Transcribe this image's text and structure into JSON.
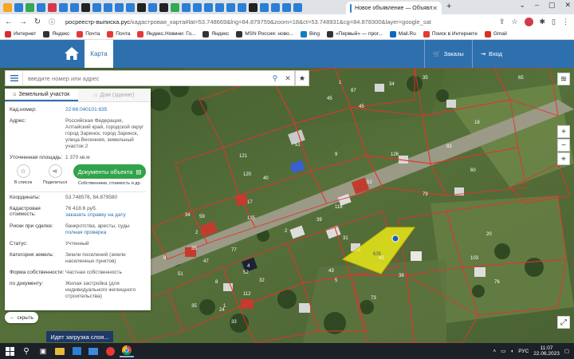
{
  "browser": {
    "active_tab_title": "Новое объявление — Объявл",
    "url_host": "росреестр-выписка.рус",
    "url_path": "/кадастровая_карта#lat=53.748669&lng=84.879759&zoom=18&ct=53.748931&cg=84.878300&layer=google_sat",
    "bookmarks": [
      {
        "label": "Интернет",
        "color": "#d32f2f"
      },
      {
        "label": "Яндекс",
        "color": "#333333"
      },
      {
        "label": "Почта",
        "color": "#e53935"
      },
      {
        "label": "Почта",
        "color": "#e53935"
      },
      {
        "label": "Яндекс.Новини: Го...",
        "color": "#e53935"
      },
      {
        "label": "Яндекс",
        "color": "#333333"
      },
      {
        "label": "MSN Россия: ново...",
        "color": "#333333"
      },
      {
        "label": "Bing",
        "color": "#0f7dc2"
      },
      {
        "label": "«Первый» — прог...",
        "color": "#333333"
      },
      {
        "label": "Mail.Ru",
        "color": "#0c66c2"
      },
      {
        "label": "Поиск в Интернете",
        "color": "#e53935"
      },
      {
        "label": "Gmail",
        "color": "#d93025"
      }
    ]
  },
  "header": {
    "map_tab": "Карта",
    "orders": "Заказы",
    "login": "Вход"
  },
  "search": {
    "placeholder": "введите номер или адрес"
  },
  "panel": {
    "tab_land": "Земельный участок",
    "tab_building": "Дом (здание)",
    "cad_label": "Кад.номер:",
    "cad_value": "22:66:040101:635",
    "addr_label": "Адрес:",
    "addr_value": "Российская Федерация, Алтайский край, городской округ город Заринск, город Заринск, улица Весенняя, земельный участок 2",
    "area_label": "Уточненная площадь:",
    "area_value": "1 370 кв.м",
    "in_list": "В список",
    "share": "Поделиться",
    "docs_button": "Документы объекта",
    "docs_sub": "Собственники, стоимость и др.",
    "coords_label": "Координаты:",
    "coords_value": "53.748576, 84.879580",
    "cost_label": "Кадастровая стоимость:",
    "cost_value": "76 418.6 руб.",
    "cost_link": "заказать справку на дату",
    "risks_label": "Риски при сделке:",
    "risks_value": "банкротства, аресты, суды",
    "risks_link": "полная проверка",
    "status_label": "Статус:",
    "status_value": "Учтенный",
    "category_label": "Категория земель:",
    "category_value": "Земли поселений (земли населенных пунктов)",
    "ownership_label": "Форма собственности:",
    "ownership_value": "Частная собственность",
    "doc_label": "по документу:",
    "doc_value": "Жилая застройка (для индивидуального жилищного строительства)"
  },
  "hide_button": "скрыть",
  "loading_text": "Идет загрузка слоя...",
  "map_labels": [
    "65",
    "34",
    "35",
    "87",
    "45",
    "45",
    "1",
    "83",
    "18",
    "51",
    "126",
    "60",
    "9",
    "121",
    "120",
    "40",
    "17",
    "135",
    "59",
    "34",
    "2",
    "35",
    "9",
    "51",
    "47",
    "77",
    "116",
    "52",
    "79",
    "31",
    "42",
    "43",
    "2",
    "39",
    "32",
    "4",
    "8",
    "52",
    "35",
    "24",
    "112",
    "5",
    "38",
    "1",
    "33",
    "73",
    "103",
    "20",
    "76"
  ],
  "selected_label": "635",
  "taskbar": {
    "lang": "РУС",
    "time": "11:07",
    "date": "22.06.2023"
  },
  "colors": {
    "header_blue": "#2e6fae",
    "button_green": "#31a34a",
    "parcel_border": "#e5322d",
    "selected_fill": "#e8e81a"
  }
}
